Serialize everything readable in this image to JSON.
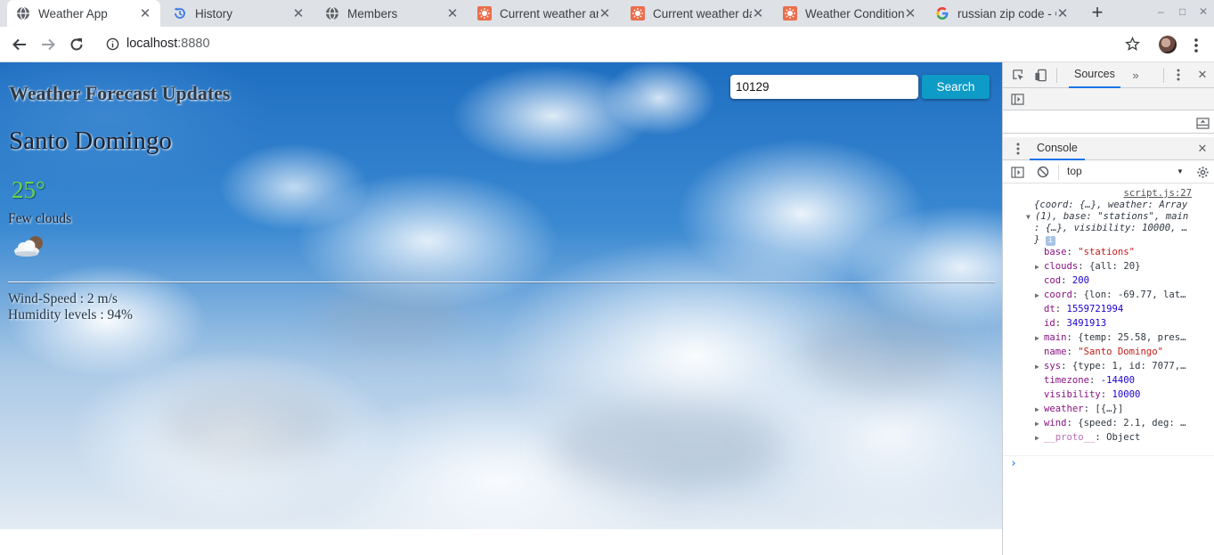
{
  "browser": {
    "tabs": [
      {
        "title": "Weather App",
        "icon": "globe-icon",
        "active": true
      },
      {
        "title": "History",
        "icon": "history-icon",
        "active": false
      },
      {
        "title": "Members",
        "icon": "globe-icon",
        "active": false
      },
      {
        "title": "Current weather ar",
        "icon": "openweather-icon",
        "active": false
      },
      {
        "title": "Current weather da",
        "icon": "openweather-icon",
        "active": false
      },
      {
        "title": "Weather Conditions",
        "icon": "openweather-icon",
        "active": false
      },
      {
        "title": "russian zip code - G",
        "icon": "google-icon",
        "active": false
      }
    ],
    "address": {
      "host": "localhost",
      "port": ":8880"
    }
  },
  "app": {
    "heading": "Weather Forecast Updates",
    "search_value": "10129",
    "search_button": "Search",
    "city": "Santo Domingo",
    "temperature": "25°",
    "condition": "Few clouds",
    "wind": "Wind-Speed : 2 m/s",
    "humidity": "Humidity levels : 94%"
  },
  "devtools": {
    "top_tab": "Sources",
    "drawer_tab": "Console",
    "context": "top",
    "log_source": "script.js:27",
    "summary_lines": [
      "{coord: {…}, weather: Array",
      "(1), base: \"stations\", main",
      ": {…}, visibility: 10000, …",
      "}"
    ],
    "props": [
      {
        "key": "base",
        "value": "\"stations\"",
        "expandable": false,
        "kind": "string"
      },
      {
        "key": "clouds",
        "value": "{all: 20}",
        "expandable": true,
        "kind": "object"
      },
      {
        "key": "cod",
        "value": "200",
        "expandable": false,
        "kind": "number"
      },
      {
        "key": "coord",
        "value": "{lon: -69.77, lat…",
        "expandable": true,
        "kind": "object"
      },
      {
        "key": "dt",
        "value": "1559721994",
        "expandable": false,
        "kind": "number"
      },
      {
        "key": "id",
        "value": "3491913",
        "expandable": false,
        "kind": "number"
      },
      {
        "key": "main",
        "value": "{temp: 25.58, pres…",
        "expandable": true,
        "kind": "object"
      },
      {
        "key": "name",
        "value": "\"Santo Domingo\"",
        "expandable": false,
        "kind": "string"
      },
      {
        "key": "sys",
        "value": "{type: 1, id: 7077,…",
        "expandable": true,
        "kind": "object"
      },
      {
        "key": "timezone",
        "value": "-14400",
        "expandable": false,
        "kind": "number"
      },
      {
        "key": "visibility",
        "value": "10000",
        "expandable": false,
        "kind": "number"
      },
      {
        "key": "weather",
        "value": "[{…}]",
        "expandable": true,
        "kind": "object"
      },
      {
        "key": "wind",
        "value": "{speed: 2.1, deg: …",
        "expandable": true,
        "kind": "object"
      },
      {
        "key": "__proto__",
        "value": "Object",
        "expandable": true,
        "kind": "object"
      }
    ]
  }
}
